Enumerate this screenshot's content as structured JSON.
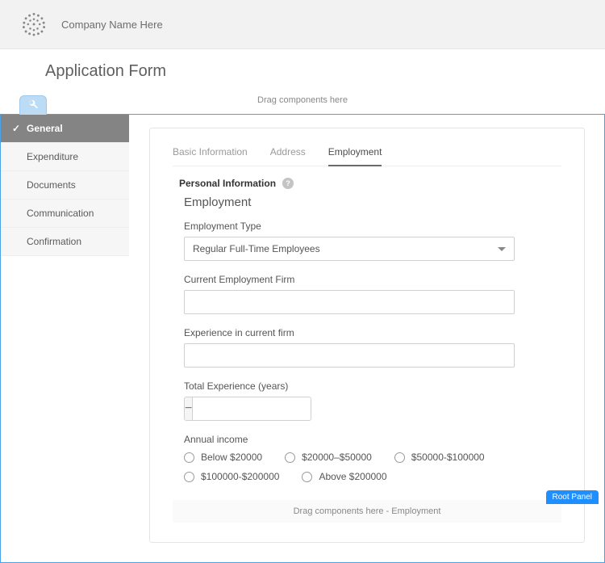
{
  "header": {
    "company_name": "Company Name Here"
  },
  "page_title": "Application Form",
  "drop_hint_top": "Drag components here",
  "sidebar": {
    "items": [
      {
        "label": "General",
        "active": true
      },
      {
        "label": "Expenditure",
        "active": false
      },
      {
        "label": "Documents",
        "active": false
      },
      {
        "label": "Communication",
        "active": false
      },
      {
        "label": "Confirmation",
        "active": false
      }
    ]
  },
  "tabs": [
    {
      "label": "Basic Information",
      "active": false
    },
    {
      "label": "Address",
      "active": false
    },
    {
      "label": "Employment",
      "active": true
    }
  ],
  "section": {
    "title": "Personal Information",
    "info_icon": "?"
  },
  "subsection_title": "Employment",
  "fields": {
    "employment_type": {
      "label": "Employment Type",
      "value": "Regular Full-Time Employees"
    },
    "current_firm": {
      "label": "Current Employment Firm",
      "value": ""
    },
    "experience_current": {
      "label": "Experience in current firm",
      "value": ""
    },
    "total_experience": {
      "label": "Total Experience (years)",
      "minus": "−",
      "plus": "+",
      "value": ""
    },
    "annual_income": {
      "label": "Annual income",
      "options": [
        "Below $20000",
        "$20000–$50000",
        "$50000-$100000",
        "$100000-$200000",
        "Above $200000"
      ]
    }
  },
  "drop_hint_inner": "Drag components here - Employment",
  "root_panel_btn": "Root Panel"
}
